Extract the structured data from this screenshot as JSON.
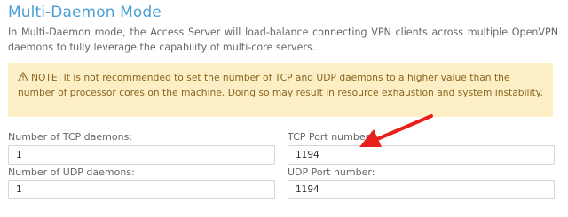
{
  "section": {
    "title": "Multi-Daemon Mode",
    "description": "In Multi-Daemon mode, the Access Server will load-balance connecting VPN clients across multiple OpenVPN daemons to fully leverage the capability of multi-core servers."
  },
  "note": {
    "text": "NOTE: It is not recommended to set the number of TCP and UDP daemons to a higher value than the number of processor cores on the machine. Doing so may result in resource exhaustion and system instability.",
    "icon": "warning-icon"
  },
  "fields": {
    "tcp_daemons": {
      "label": "Number of TCP daemons:",
      "value": "1"
    },
    "tcp_port": {
      "label": "TCP Port number:",
      "value": "1194"
    },
    "udp_daemons": {
      "label": "Number of UDP daemons:",
      "value": "1"
    },
    "udp_port": {
      "label": "UDP Port number:",
      "value": "1194"
    }
  },
  "colors": {
    "title": "#4aa0d5",
    "note_background": "#fcefc6",
    "note_text": "#8a6420",
    "annotation_arrow": "#e8201b"
  }
}
